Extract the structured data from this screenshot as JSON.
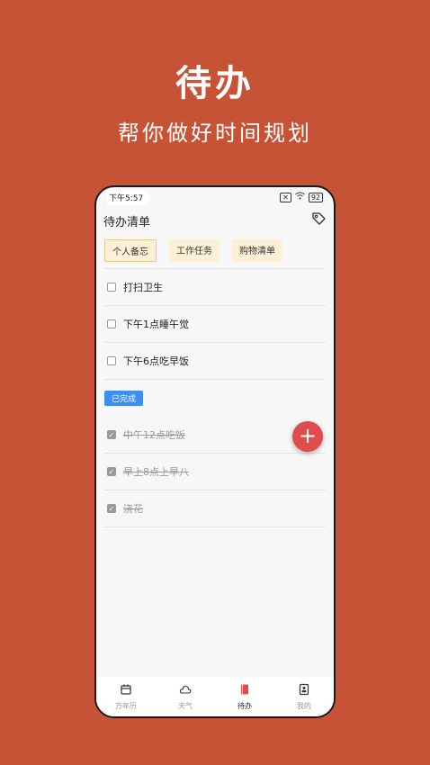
{
  "hero": {
    "title": "待办",
    "subtitle": "帮你做好时间规划"
  },
  "status_bar": {
    "time": "下午5:57",
    "battery": "92"
  },
  "header": {
    "title": "待办清单",
    "tag_icon": "tag-icon"
  },
  "tabs": [
    {
      "label": "个人备忘",
      "active": true
    },
    {
      "label": "工作任务",
      "active": false
    },
    {
      "label": "购物清单",
      "active": false
    }
  ],
  "todos": [
    {
      "text": "打扫卫生",
      "done": false
    },
    {
      "text": "下午1点睡午觉",
      "done": false
    },
    {
      "text": "下午6点吃早饭",
      "done": false
    }
  ],
  "done_section": {
    "label": "已完成",
    "items": [
      {
        "text": "中午12点吃饭",
        "done": true
      },
      {
        "text": "早上8点上早八",
        "done": true
      },
      {
        "text": "浇花",
        "done": true
      }
    ]
  },
  "fab": {
    "label": "+"
  },
  "bottom_nav": [
    {
      "label": "万年历",
      "icon": "calendar-icon",
      "active": false
    },
    {
      "label": "天气",
      "icon": "cloud-icon",
      "active": false
    },
    {
      "label": "待办",
      "icon": "notebook-icon",
      "active": true
    },
    {
      "label": "我的",
      "icon": "profile-icon",
      "active": false
    }
  ],
  "colors": {
    "background": "#C65336",
    "accent": "#E04C4C",
    "badge": "#3E8EF0",
    "tab_bg": "#FCF1D7"
  }
}
